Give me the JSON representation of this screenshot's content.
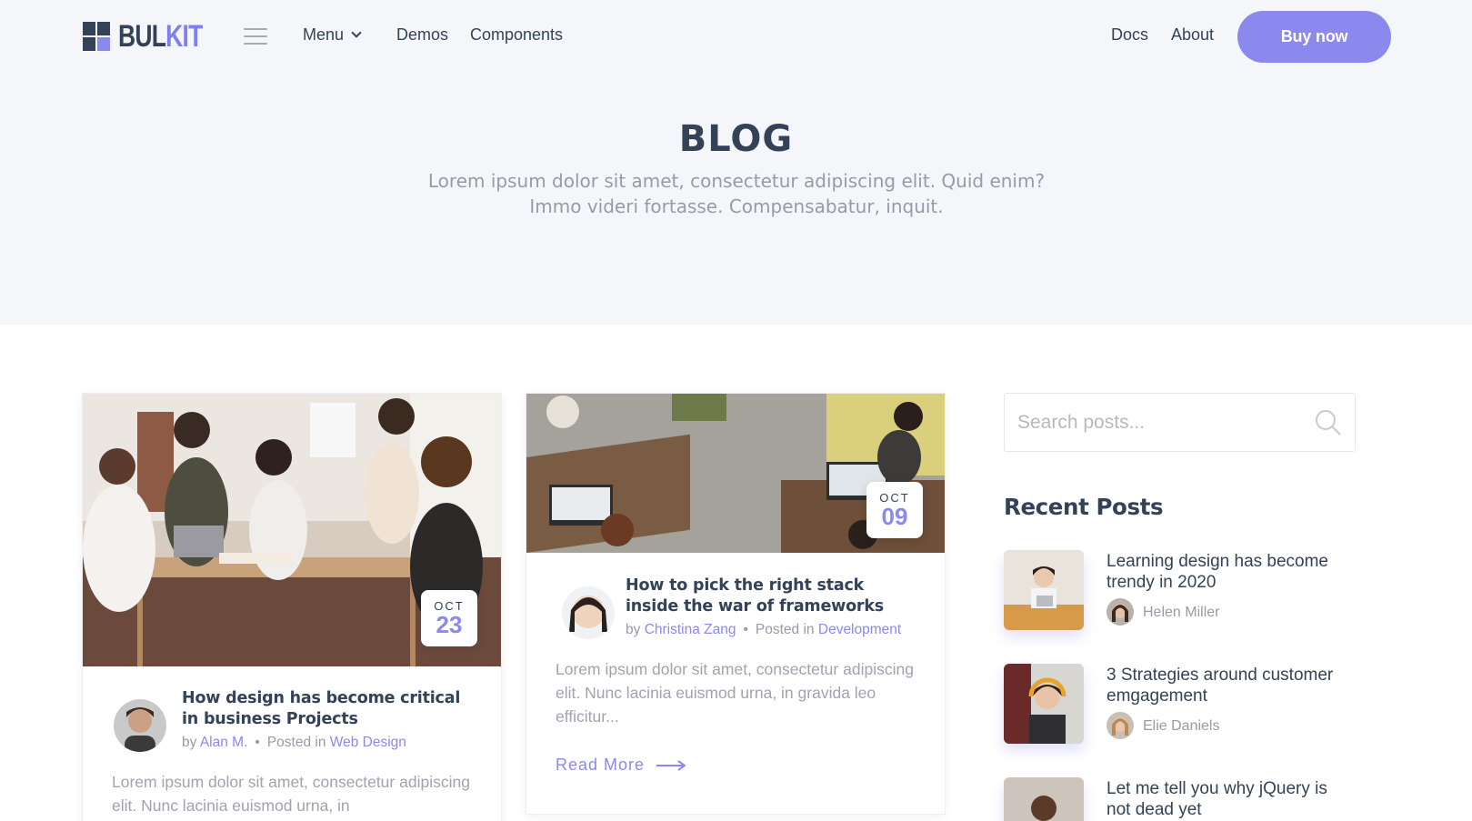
{
  "nav": {
    "logo_part1": "BUL",
    "logo_part2": "KIT",
    "menu_label": "Menu",
    "demos_label": "Demos",
    "components_label": "Components",
    "docs_label": "Docs",
    "about_label": "About",
    "buy_label": "Buy now"
  },
  "hero": {
    "title": "BLOG",
    "subtitle": "Lorem ipsum dolor sit amet, consectetur adipiscing elit. Quid enim? Immo videri fortasse. Compensabatur, inquit."
  },
  "posts": [
    {
      "date_month": "OCT",
      "date_day": "23",
      "title": "How design has become critical in business Projects",
      "by": "by",
      "author": "Alan M.",
      "posted_in": "Posted in",
      "category": "Web Design",
      "excerpt": "Lorem ipsum dolor sit amet, consectetur adipiscing elit. Nunc lacinia euismod urna, in"
    },
    {
      "date_month": "OCT",
      "date_day": "09",
      "title": "How to pick the right stack inside the war of frameworks",
      "by": "by",
      "author": "Christina Zang",
      "posted_in": "Posted in",
      "category": "Development",
      "excerpt": "Lorem ipsum dolor sit amet, consectetur adipiscing elit. Nunc lacinia euismod urna, in gravida leo efficitur...",
      "read_more": "Read More"
    }
  ],
  "sidebar": {
    "search_placeholder": "Search posts...",
    "recent_title": "Recent Posts",
    "recent_posts": [
      {
        "title": "Learning design has become trendy in 2020",
        "author": "Helen Miller"
      },
      {
        "title": "3 Strategies around customer emgagement",
        "author": "Elie Daniels"
      },
      {
        "title": "Let me tell you why jQuery is not dead yet",
        "author": ""
      }
    ]
  },
  "colors": {
    "accent": "#8b88ee",
    "heading": "#344258",
    "muted": "#999aa6",
    "hero_bg": "#f5f6fa"
  }
}
